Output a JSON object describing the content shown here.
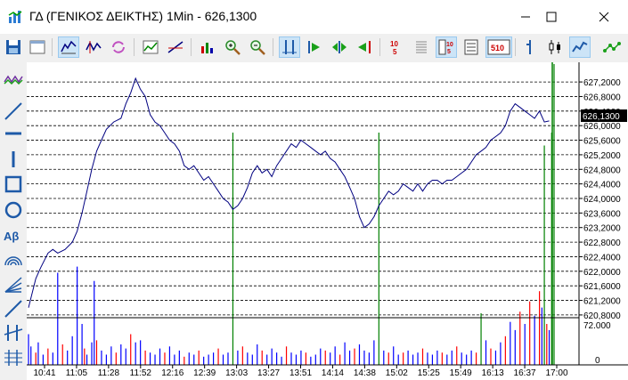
{
  "window": {
    "title": "ΓΔ (ΓΕΝΙΚΟΣ ΔΕΙΚΤΗΣ) 1Min - 626,1300"
  },
  "toolbar": {
    "icons": [
      "save-icon",
      "window-icon",
      "line-chart-icon",
      "candlestick-icon",
      "refresh-icon",
      "chart-type-icon",
      "trendline-icon",
      "indicator-icon",
      "zoom-in-icon",
      "zoom-out-icon",
      "align-icon",
      "play-icon",
      "play-both-icon",
      "step-back-icon",
      "text-scale-icon",
      "column-icon",
      "value-box-icon",
      "scale-510-icon",
      "bar-icon",
      "ohlc-icon",
      "line-icon",
      "network-icon"
    ],
    "value_box_label": "10\n5",
    "scale_label": "510"
  },
  "left_toolbar": {
    "icons": [
      "zigzag-icon",
      "diagonal-line-icon",
      "horizontal-line-icon",
      "vertical-line-icon",
      "rectangle-icon",
      "ellipse-icon",
      "text-icon",
      "arc-icon",
      "fan-icon",
      "ray-icon",
      "parallel-icon",
      "fibonacci-icon"
    ],
    "text_label": "Aβ"
  },
  "chart_data": {
    "type": "line",
    "price_axis": {
      "ylim": [
        620.7,
        627.3
      ],
      "ticks": [
        "627,2000",
        "626,8000",
        "626,4000",
        "626,0000",
        "625,6000",
        "625,2000",
        "624,8000",
        "624,4000",
        "624,0000",
        "623,6000",
        "623,2000",
        "622,8000",
        "622,4000",
        "622,0000",
        "621,6000",
        "621,2000",
        "620,8000"
      ],
      "current_value": "626,1300"
    },
    "volume_axis": {
      "ticks": [
        "72.000",
        "0"
      ],
      "ylim": [
        0,
        100000
      ]
    },
    "x_ticks": [
      "10:41",
      "11:05",
      "11:28",
      "11:52",
      "12:16",
      "12:39",
      "13:03",
      "13:27",
      "13:51",
      "14:14",
      "14:38",
      "15:02",
      "15:25",
      "15:49",
      "16:13",
      "16:37",
      "17:00"
    ],
    "price_series": {
      "color": "#000080",
      "points": [
        [
          0,
          621.0
        ],
        [
          3,
          621.8
        ],
        [
          5,
          622.1
        ],
        [
          8,
          622.5
        ],
        [
          10,
          622.6
        ],
        [
          12,
          622.5
        ],
        [
          15,
          622.6
        ],
        [
          18,
          622.8
        ],
        [
          20,
          623.1
        ],
        [
          22,
          623.6
        ],
        [
          24,
          624.2
        ],
        [
          26,
          624.8
        ],
        [
          28,
          625.3
        ],
        [
          30,
          625.6
        ],
        [
          32,
          625.9
        ],
        [
          35,
          626.1
        ],
        [
          38,
          626.2
        ],
        [
          40,
          626.6
        ],
        [
          42,
          626.9
        ],
        [
          44,
          627.3
        ],
        [
          46,
          627.0
        ],
        [
          48,
          626.8
        ],
        [
          50,
          626.3
        ],
        [
          52,
          626.1
        ],
        [
          54,
          626.0
        ],
        [
          56,
          625.8
        ],
        [
          58,
          625.6
        ],
        [
          60,
          625.5
        ],
        [
          62,
          625.3
        ],
        [
          64,
          624.9
        ],
        [
          66,
          624.8
        ],
        [
          68,
          624.9
        ],
        [
          70,
          624.7
        ],
        [
          72,
          624.5
        ],
        [
          74,
          624.6
        ],
        [
          76,
          624.4
        ],
        [
          78,
          624.2
        ],
        [
          80,
          624.0
        ],
        [
          82,
          623.9
        ],
        [
          84,
          623.7
        ],
        [
          86,
          623.8
        ],
        [
          88,
          624.0
        ],
        [
          90,
          624.3
        ],
        [
          92,
          624.7
        ],
        [
          94,
          624.9
        ],
        [
          96,
          624.7
        ],
        [
          98,
          624.8
        ],
        [
          100,
          624.6
        ],
        [
          102,
          624.9
        ],
        [
          104,
          625.1
        ],
        [
          106,
          625.3
        ],
        [
          108,
          625.5
        ],
        [
          110,
          625.4
        ],
        [
          112,
          625.6
        ],
        [
          114,
          625.5
        ],
        [
          116,
          625.4
        ],
        [
          118,
          625.3
        ],
        [
          120,
          625.2
        ],
        [
          122,
          625.3
        ],
        [
          124,
          625.1
        ],
        [
          126,
          625.0
        ],
        [
          128,
          624.8
        ],
        [
          130,
          624.6
        ],
        [
          132,
          624.3
        ],
        [
          134,
          624.0
        ],
        [
          136,
          623.5
        ],
        [
          138,
          623.2
        ],
        [
          140,
          623.3
        ],
        [
          142,
          623.5
        ],
        [
          144,
          623.8
        ],
        [
          146,
          624.0
        ],
        [
          148,
          624.2
        ],
        [
          150,
          624.1
        ],
        [
          152,
          624.2
        ],
        [
          154,
          624.4
        ],
        [
          156,
          624.3
        ],
        [
          158,
          624.2
        ],
        [
          160,
          624.4
        ],
        [
          162,
          624.2
        ],
        [
          164,
          624.4
        ],
        [
          166,
          624.5
        ],
        [
          168,
          624.5
        ],
        [
          170,
          624.4
        ],
        [
          172,
          624.5
        ],
        [
          174,
          624.5
        ],
        [
          176,
          624.6
        ],
        [
          178,
          624.7
        ],
        [
          180,
          624.8
        ],
        [
          182,
          625.0
        ],
        [
          184,
          625.2
        ],
        [
          186,
          625.3
        ],
        [
          188,
          625.4
        ],
        [
          190,
          625.6
        ],
        [
          192,
          625.7
        ],
        [
          194,
          625.8
        ],
        [
          196,
          626.0
        ],
        [
          198,
          626.4
        ],
        [
          200,
          626.6
        ],
        [
          202,
          626.5
        ],
        [
          204,
          626.4
        ],
        [
          206,
          626.3
        ],
        [
          208,
          626.2
        ],
        [
          210,
          626.4
        ],
        [
          212,
          626.1
        ],
        [
          214,
          626.13
        ]
      ]
    },
    "volume_series": {
      "colors": {
        "up": "#0000ff",
        "down": "#ff0000",
        "spike": "#008000"
      },
      "bars": [
        [
          0,
          30,
          "up"
        ],
        [
          1,
          18,
          "up"
        ],
        [
          3,
          12,
          "down"
        ],
        [
          4,
          22,
          "up"
        ],
        [
          6,
          10,
          "up"
        ],
        [
          8,
          16,
          "down"
        ],
        [
          10,
          12,
          "up"
        ],
        [
          12,
          90,
          "up"
        ],
        [
          14,
          20,
          "down"
        ],
        [
          16,
          14,
          "up"
        ],
        [
          18,
          28,
          "up"
        ],
        [
          20,
          96,
          "up"
        ],
        [
          22,
          40,
          "up"
        ],
        [
          23,
          16,
          "down"
        ],
        [
          24,
          10,
          "up"
        ],
        [
          26,
          22,
          "up"
        ],
        [
          27,
          82,
          "up"
        ],
        [
          28,
          24,
          "down"
        ],
        [
          30,
          14,
          "up"
        ],
        [
          32,
          10,
          "up"
        ],
        [
          34,
          18,
          "up"
        ],
        [
          36,
          12,
          "down"
        ],
        [
          38,
          20,
          "up"
        ],
        [
          40,
          16,
          "up"
        ],
        [
          42,
          30,
          "down"
        ],
        [
          44,
          22,
          "up"
        ],
        [
          46,
          24,
          "up"
        ],
        [
          48,
          14,
          "down"
        ],
        [
          50,
          12,
          "up"
        ],
        [
          52,
          10,
          "up"
        ],
        [
          54,
          16,
          "up"
        ],
        [
          56,
          12,
          "down"
        ],
        [
          58,
          18,
          "up"
        ],
        [
          60,
          10,
          "up"
        ],
        [
          62,
          14,
          "up"
        ],
        [
          64,
          8,
          "down"
        ],
        [
          66,
          12,
          "up"
        ],
        [
          68,
          10,
          "up"
        ],
        [
          70,
          14,
          "down"
        ],
        [
          72,
          8,
          "up"
        ],
        [
          74,
          10,
          "up"
        ],
        [
          76,
          12,
          "up"
        ],
        [
          78,
          16,
          "down"
        ],
        [
          80,
          10,
          "up"
        ],
        [
          82,
          12,
          "up"
        ],
        [
          84,
          90,
          "spike"
        ],
        [
          86,
          14,
          "up"
        ],
        [
          88,
          18,
          "down"
        ],
        [
          90,
          12,
          "up"
        ],
        [
          92,
          10,
          "up"
        ],
        [
          94,
          20,
          "up"
        ],
        [
          96,
          14,
          "down"
        ],
        [
          98,
          10,
          "up"
        ],
        [
          100,
          16,
          "up"
        ],
        [
          102,
          12,
          "up"
        ],
        [
          104,
          8,
          "up"
        ],
        [
          106,
          18,
          "down"
        ],
        [
          108,
          12,
          "up"
        ],
        [
          110,
          10,
          "up"
        ],
        [
          112,
          14,
          "up"
        ],
        [
          114,
          12,
          "down"
        ],
        [
          116,
          8,
          "up"
        ],
        [
          118,
          10,
          "up"
        ],
        [
          120,
          16,
          "up"
        ],
        [
          122,
          14,
          "down"
        ],
        [
          124,
          12,
          "up"
        ],
        [
          126,
          18,
          "up"
        ],
        [
          128,
          10,
          "down"
        ],
        [
          130,
          22,
          "up"
        ],
        [
          132,
          14,
          "up"
        ],
        [
          134,
          16,
          "down"
        ],
        [
          136,
          20,
          "up"
        ],
        [
          138,
          14,
          "up"
        ],
        [
          140,
          12,
          "up"
        ],
        [
          142,
          24,
          "up"
        ],
        [
          144,
          90,
          "spike"
        ],
        [
          146,
          14,
          "up"
        ],
        [
          148,
          12,
          "down"
        ],
        [
          150,
          18,
          "up"
        ],
        [
          152,
          10,
          "up"
        ],
        [
          154,
          12,
          "down"
        ],
        [
          156,
          14,
          "up"
        ],
        [
          158,
          10,
          "up"
        ],
        [
          160,
          12,
          "up"
        ],
        [
          162,
          16,
          "down"
        ],
        [
          164,
          12,
          "up"
        ],
        [
          166,
          10,
          "up"
        ],
        [
          168,
          14,
          "up"
        ],
        [
          170,
          12,
          "down"
        ],
        [
          172,
          10,
          "up"
        ],
        [
          174,
          14,
          "up"
        ],
        [
          176,
          18,
          "down"
        ],
        [
          178,
          12,
          "up"
        ],
        [
          180,
          10,
          "up"
        ],
        [
          182,
          14,
          "up"
        ],
        [
          184,
          12,
          "down"
        ],
        [
          186,
          20,
          "spike"
        ],
        [
          188,
          24,
          "up"
        ],
        [
          190,
          16,
          "down"
        ],
        [
          192,
          14,
          "up"
        ],
        [
          194,
          22,
          "up"
        ],
        [
          196,
          28,
          "down"
        ],
        [
          198,
          42,
          "up"
        ],
        [
          200,
          34,
          "up"
        ],
        [
          202,
          52,
          "down"
        ],
        [
          204,
          40,
          "up"
        ],
        [
          206,
          62,
          "down"
        ],
        [
          208,
          48,
          "up"
        ],
        [
          210,
          72,
          "down"
        ],
        [
          211,
          56,
          "up"
        ],
        [
          212,
          85,
          "spike"
        ],
        [
          213,
          40,
          "down"
        ],
        [
          214,
          34,
          "up"
        ],
        [
          215,
          90,
          "spike"
        ],
        [
          216,
          120,
          "spike"
        ]
      ]
    },
    "grid": true
  }
}
